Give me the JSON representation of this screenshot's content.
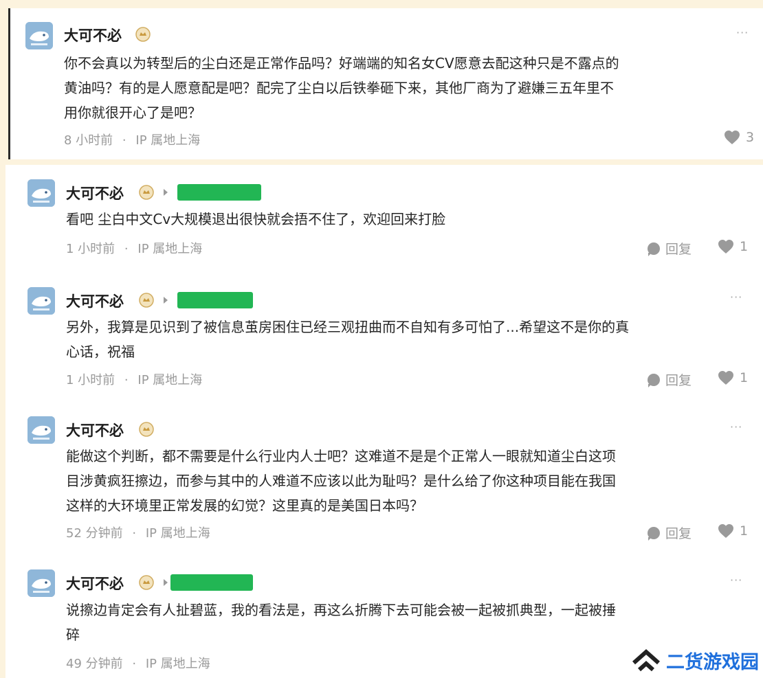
{
  "comments": [
    {
      "author": "大可不必",
      "content": "你不会真以为转型后的尘白还是正常作品吗？好端端的知名女CV愿意去配这种只是不露点的\n黄油吗？有的是人愿意配是吧？配完了尘白以后铁拳砸下来，其他厂商为了避嫌三五年里不\n用你就很开心了是吧？",
      "time": "8 小时前",
      "ip": "IP 属地上海",
      "likes": "3",
      "more": "···"
    },
    {
      "author": "大可不必",
      "content": "看吧 尘白中文Cv大规模退出很快就会捂不住了，欢迎回来打脸",
      "time": "1 小时前",
      "ip": "IP 属地上海",
      "reply_label": "回复",
      "likes": "1"
    },
    {
      "author": "大可不必",
      "content": "另外，我算是见识到了被信息茧房困住已经三观扭曲而不自知有多可怕了...希望这不是你的真\n心话，祝福",
      "time": "1 小时前",
      "ip": "IP 属地上海",
      "reply_label": "回复",
      "likes": "1",
      "more": "···"
    },
    {
      "author": "大可不必",
      "content": "能做这个判断，都不需要是什么行业内人士吧？这难道不是是个正常人一眼就知道尘白这项\n目涉黄疯狂擦边，而参与其中的人难道不应该以此为耻吗？是什么给了你这种项目能在我国\n这样的大环境里正常发展的幻觉？这里真的是美国日本吗？",
      "time": "52 分钟前",
      "ip": "IP 属地上海",
      "reply_label": "回复",
      "likes": "1",
      "more": "···"
    },
    {
      "author": "大可不必",
      "content": "说擦边肯定会有人扯碧蓝，我的看法是，再这么折腾下去可能会被一起被抓典型，一起被捶\n碎",
      "time": "49 分钟前",
      "ip": "IP 属地上海",
      "more": "···"
    }
  ],
  "separator": "·",
  "watermark": {
    "text": "二货游戏园",
    "icon": "chevron-logo-icon"
  },
  "colors": {
    "background": "#fcf3de",
    "redaction": "#22b654",
    "watermark": "#1e6fdc"
  }
}
